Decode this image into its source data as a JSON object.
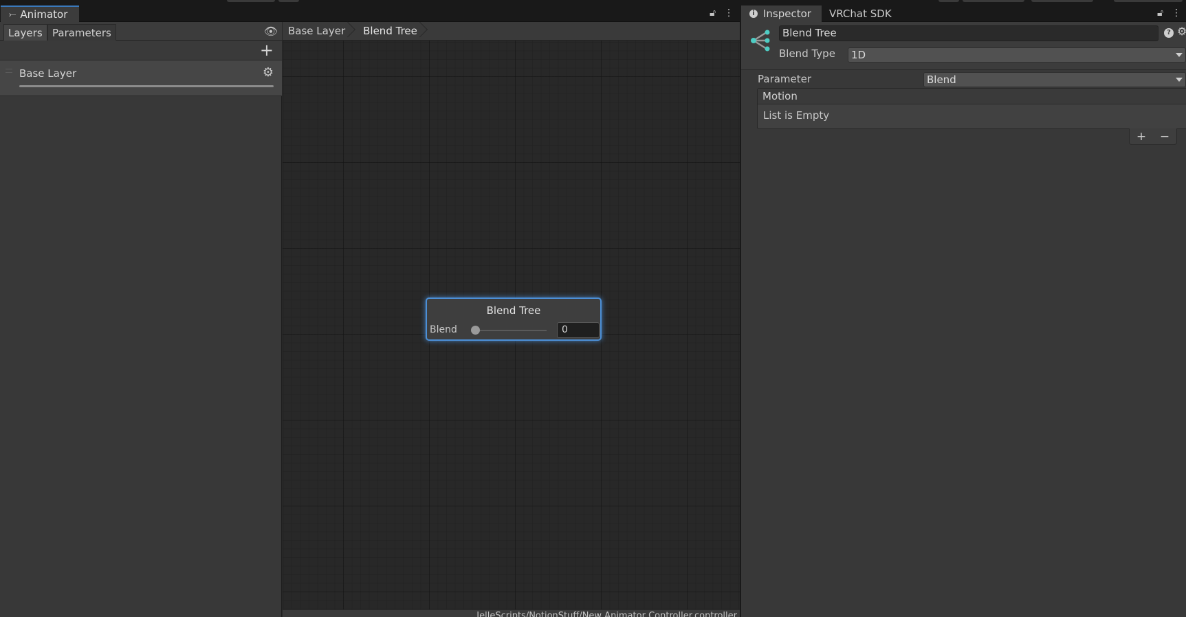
{
  "animator": {
    "window_tab": "Animator",
    "window_icon": "animator-icon",
    "left_tabs": [
      "Layers",
      "Parameters"
    ],
    "layers": [
      {
        "name": "Base Layer",
        "weight": 1.0
      }
    ],
    "breadcrumbs": [
      "Base Layer",
      "Blend Tree"
    ],
    "node": {
      "title": "Blend Tree",
      "param_label": "Blend",
      "slider_value_fraction": 0,
      "field_value": "0"
    },
    "footer_path": "JelleScripts/NotionStuff/New Animator Controller.controller"
  },
  "inspector": {
    "tabs": [
      "Inspector",
      "VRChat SDK"
    ],
    "object_name": "Blend Tree",
    "blend_type_label": "Blend Type",
    "blend_type_value": "1D",
    "parameter_label": "Parameter",
    "parameter_value": "Blend",
    "motion_header": "Motion",
    "motion_empty_text": "List is Empty",
    "add_label": "+",
    "remove_label": "−",
    "accent_color": "#4ecdc4"
  },
  "colors": {
    "selection_accent": "#4c8fd6",
    "tab_accent": "#3a79bb"
  }
}
